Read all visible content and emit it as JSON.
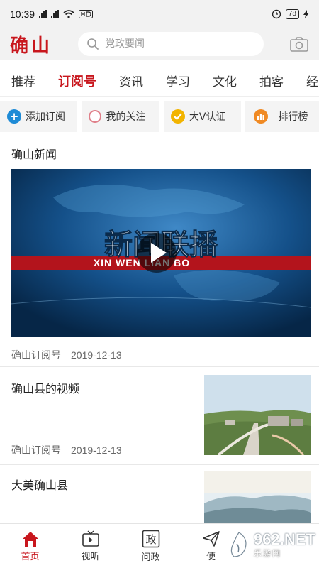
{
  "status": {
    "time": "10:39",
    "battery": "78"
  },
  "header": {
    "logo": "确山",
    "search_placeholder": "党政要闻"
  },
  "tabs": [
    {
      "label": "推荐"
    },
    {
      "label": "订阅号",
      "active": true
    },
    {
      "label": "资讯"
    },
    {
      "label": "学习"
    },
    {
      "label": "文化"
    },
    {
      "label": "拍客"
    },
    {
      "label": "经"
    }
  ],
  "actions": [
    {
      "label": "添加订阅",
      "icon": "plus-circle-icon",
      "color": "#1e8bd6"
    },
    {
      "label": "我的关注",
      "icon": "ring-icon",
      "color": "#e0808a"
    },
    {
      "label": "大V认证",
      "icon": "check-badge-icon",
      "color": "#f2b400"
    },
    {
      "label": "排行榜",
      "icon": "bar-chart-icon",
      "color": "#f08a24"
    }
  ],
  "feed": {
    "section_title": "确山新闻",
    "video": {
      "overlay_title": "新闻联播",
      "overlay_sub": "XIN WEN LIAN BO",
      "source": "确山订阅号",
      "date": "2019-12-13"
    },
    "items": [
      {
        "title": "确山县的视频",
        "source": "确山订阅号",
        "date": "2019-12-13"
      },
      {
        "title": "大美确山县"
      }
    ]
  },
  "bottom_nav": [
    {
      "label": "首页",
      "icon": "home-icon",
      "active": true
    },
    {
      "label": "视听",
      "icon": "tv-icon"
    },
    {
      "label": "问政",
      "icon": "zheng-icon"
    },
    {
      "label": "便",
      "icon": "send-icon"
    }
  ],
  "watermark": {
    "brand": "962.NET",
    "sub": "乐游网"
  },
  "colors": {
    "brand_red": "#c8161d",
    "bg_gray": "#f2f2f2"
  }
}
